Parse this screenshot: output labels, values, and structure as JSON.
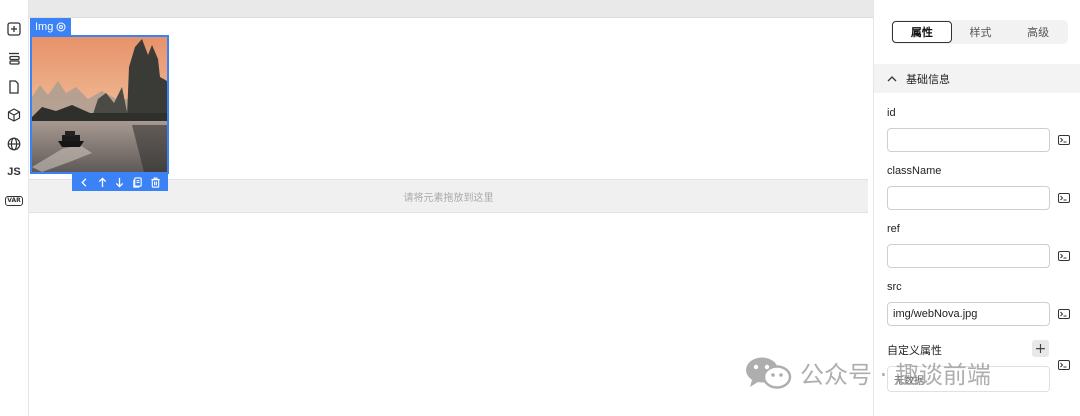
{
  "rail": {
    "items": [
      {
        "icon": "add-component-icon"
      },
      {
        "icon": "outline-tree-icon"
      },
      {
        "icon": "page-icon"
      },
      {
        "icon": "component-box-icon"
      },
      {
        "icon": "globe-icon"
      },
      {
        "label": "JS"
      },
      {
        "label": "VAR"
      }
    ]
  },
  "canvas": {
    "selected_tag": "Img",
    "dropzone_text": "请将元素拖放到这里",
    "toolbar_icons": [
      "chevron-left-icon",
      "arrow-up-icon",
      "arrow-down-icon",
      "copy-icon",
      "delete-icon"
    ]
  },
  "panel": {
    "tabs": [
      {
        "label": "属性",
        "active": true
      },
      {
        "label": "样式",
        "active": false
      },
      {
        "label": "高级",
        "active": false
      }
    ],
    "section_title": "基础信息",
    "fields": [
      {
        "label": "id",
        "value": ""
      },
      {
        "label": "className",
        "value": ""
      },
      {
        "label": "ref",
        "value": ""
      },
      {
        "label": "src",
        "value": "img/webNova.jpg"
      }
    ],
    "custom_attr_label": "自定义属性",
    "add_label": "+",
    "empty_text": "无数据"
  },
  "watermark": {
    "text": "公众号 · 趣谈前端"
  },
  "colors": {
    "accent": "#3b82f6",
    "dropzone_bg": "#f0f0f0"
  }
}
